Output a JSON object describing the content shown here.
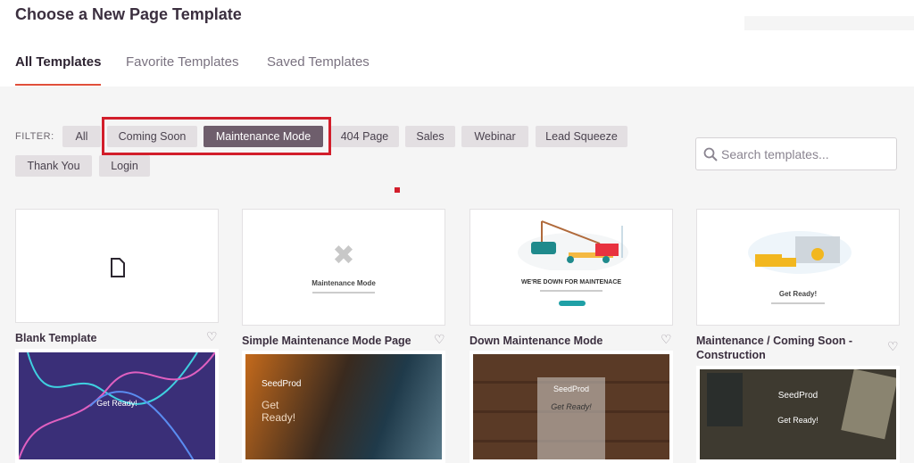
{
  "header": {
    "title": "Choose a New Page Template",
    "tabs": [
      "All Templates",
      "Favorite Templates",
      "Saved Templates"
    ]
  },
  "filter": {
    "label": "FILTER:",
    "chips": [
      "All",
      "Coming Soon",
      "Maintenance Mode",
      "404 Page",
      "Sales",
      "Webinar",
      "Lead Squeeze",
      "Thank You",
      "Login"
    ],
    "selected": "Maintenance Mode",
    "highlight_color": "#d21e2b"
  },
  "search": {
    "placeholder": "Search templates...",
    "icon": "search-icon"
  },
  "cards": [
    {
      "title": "Blank Template",
      "thumb_text": ""
    },
    {
      "title": "Simple Maintenance Mode Page",
      "thumb_text": "Maintenance Mode"
    },
    {
      "title": "Down Maintenance Mode",
      "thumb_text": "WE'RE DOWN FOR MAINTENACE"
    },
    {
      "title": "Maintenance / Coming Soon - Construction",
      "thumb_text": "Get Ready!"
    }
  ],
  "row2": [
    {
      "heading": "Get Ready!"
    },
    {
      "brand": "SeedProd",
      "heading": "Get Ready!"
    },
    {
      "brand": "SeedProd",
      "heading": "Get Ready!"
    },
    {
      "brand": "SeedProd",
      "heading": "Get Ready!"
    }
  ],
  "colors": {
    "accent": "#e04f3a",
    "selected_chip": "#6e5e6c"
  }
}
